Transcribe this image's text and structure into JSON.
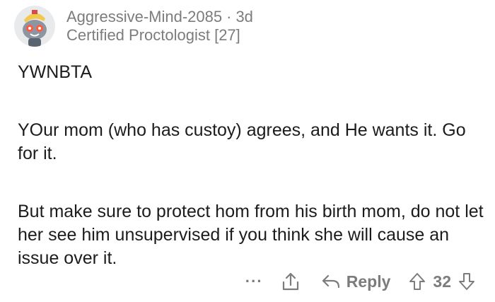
{
  "comment": {
    "author": "Aggressive-Mind-2085",
    "separator": "·",
    "age": "3d",
    "flair": "Certified Proctologist [27]",
    "paragraphs": [
      "YWNBTA",
      "YOur mom (who has custoy) agrees, and He wants it. Go for it.",
      "But make sure to protect hom from his birth mom, do not let her see him unsupervised if you think she will cause an issue over it."
    ]
  },
  "actions": {
    "more_label": "···",
    "reply_label": "Reply",
    "vote_count": "32"
  },
  "icons": {
    "more": "more-options-icon",
    "share": "share-icon",
    "reply": "reply-arrow-icon",
    "upvote": "upvote-arrow-icon",
    "downvote": "downvote-arrow-icon"
  },
  "colors": {
    "meta_text": "#7c7c7c",
    "body_text": "#1c1c1c",
    "action_text": "#7c7c7c"
  }
}
